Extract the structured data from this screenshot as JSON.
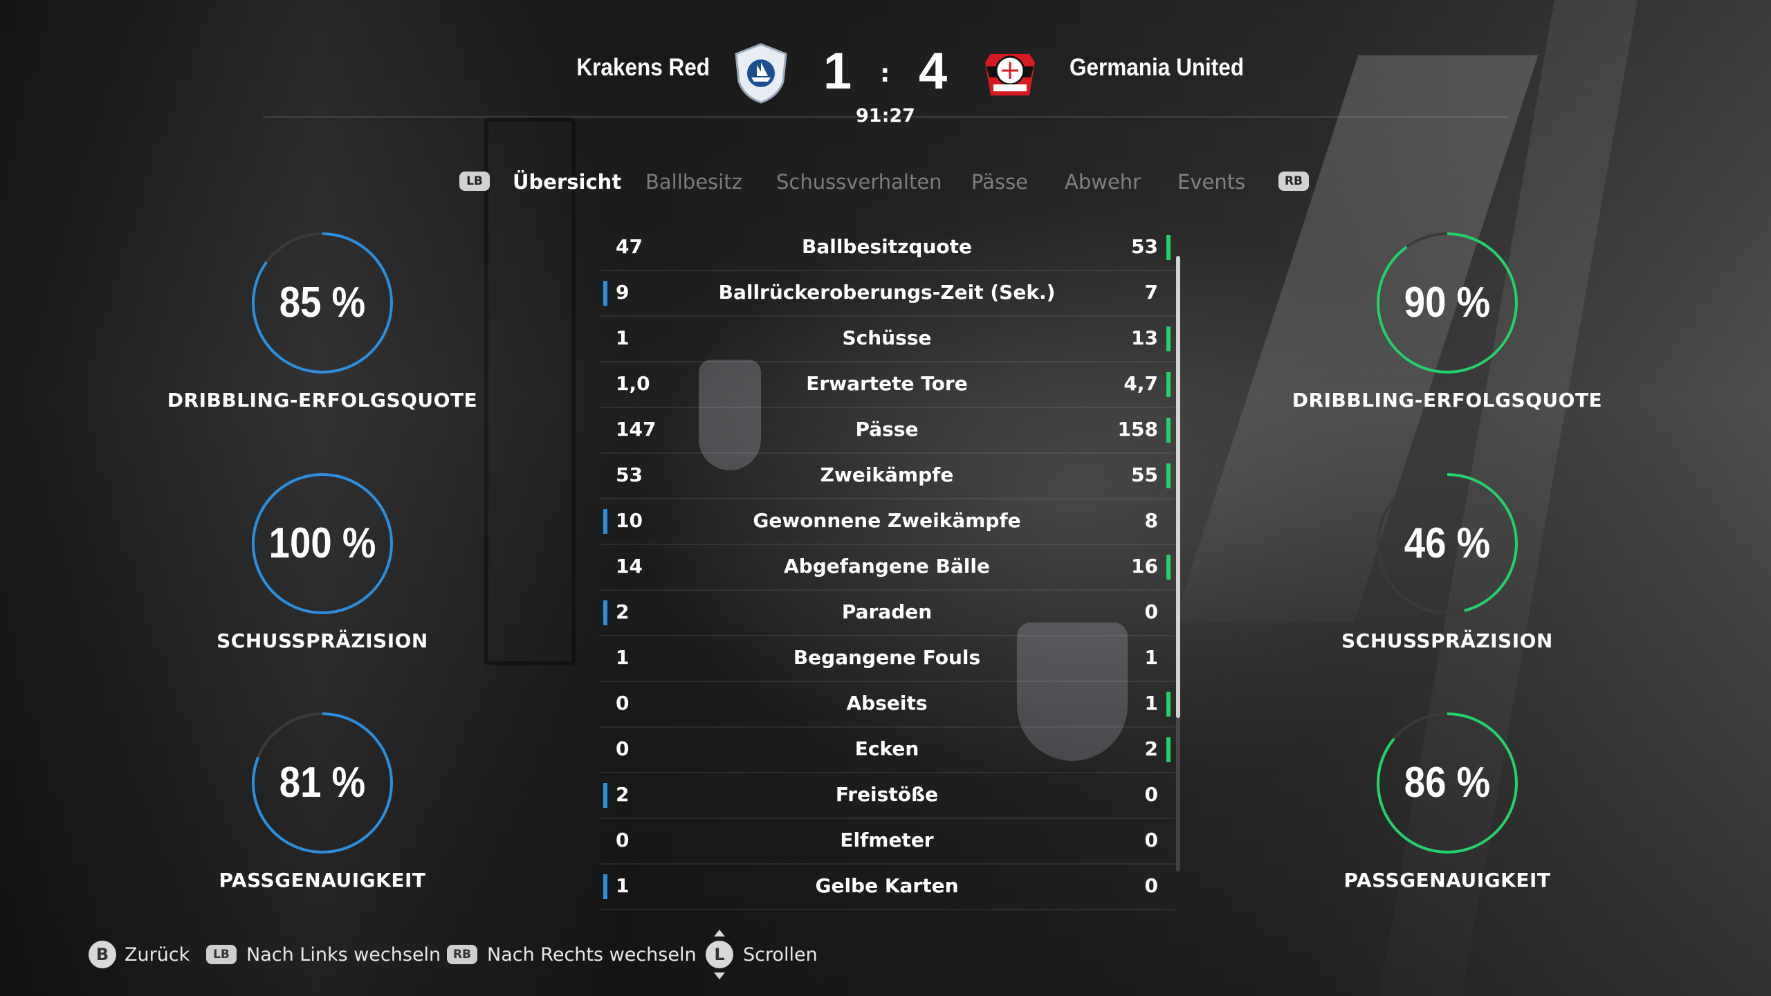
{
  "header": {
    "home_team": "Krakens Red",
    "away_team": "Germania United",
    "home_score": "1",
    "separator": ":",
    "away_score": "4",
    "clock": "91:27",
    "home_crest_icon": "kraken-shield-crest",
    "away_crest_icon": "bayer-leverkusen-crest"
  },
  "tabs": {
    "prev_pill": "LB",
    "next_pill": "RB",
    "items": [
      {
        "label": "Übersicht",
        "active": true
      },
      {
        "label": "Ballbesitz",
        "active": false
      },
      {
        "label": "Schussverhalten",
        "active": false
      },
      {
        "label": "Pässe",
        "active": false
      },
      {
        "label": "Abwehr",
        "active": false
      },
      {
        "label": "Events",
        "active": false
      }
    ]
  },
  "colors": {
    "home": "#2a8fe0",
    "away": "#22d36a",
    "track": "#3a3a3a"
  },
  "home_rings": [
    {
      "value": "85 %",
      "fraction": 0.85,
      "label": "DRIBBLING-ERFOLGSQUOTE"
    },
    {
      "value": "100 %",
      "fraction": 1.0,
      "label": "SCHUSSPRÄZISION"
    },
    {
      "value": "81 %",
      "fraction": 0.81,
      "label": "PASSGENAUIGKEIT"
    }
  ],
  "away_rings": [
    {
      "value": "90 %",
      "fraction": 0.9,
      "label": "DRIBBLING-ERFOLGSQUOTE"
    },
    {
      "value": "46 %",
      "fraction": 0.46,
      "label": "SCHUSSPRÄZISION"
    },
    {
      "value": "86 %",
      "fraction": 0.86,
      "label": "PASSGENAUIGKEIT"
    }
  ],
  "stats": [
    {
      "name": "Ballbesitzquote",
      "home": "47",
      "away": "53",
      "leader": "away"
    },
    {
      "name": "Ballrückeroberungs-Zeit (Sek.)",
      "home": "9",
      "away": "7",
      "leader": "home"
    },
    {
      "name": "Schüsse",
      "home": "1",
      "away": "13",
      "leader": "away"
    },
    {
      "name": "Erwartete Tore",
      "home": "1,0",
      "away": "4,7",
      "leader": "away"
    },
    {
      "name": "Pässe",
      "home": "147",
      "away": "158",
      "leader": "away"
    },
    {
      "name": "Zweikämpfe",
      "home": "53",
      "away": "55",
      "leader": "away"
    },
    {
      "name": "Gewonnene Zweikämpfe",
      "home": "10",
      "away": "8",
      "leader": "home"
    },
    {
      "name": "Abgefangene Bälle",
      "home": "14",
      "away": "16",
      "leader": "away"
    },
    {
      "name": "Paraden",
      "home": "2",
      "away": "0",
      "leader": "home"
    },
    {
      "name": "Begangene Fouls",
      "home": "1",
      "away": "1",
      "leader": "none"
    },
    {
      "name": "Abseits",
      "home": "0",
      "away": "1",
      "leader": "away"
    },
    {
      "name": "Ecken",
      "home": "0",
      "away": "2",
      "leader": "away"
    },
    {
      "name": "Freistöße",
      "home": "2",
      "away": "0",
      "leader": "home"
    },
    {
      "name": "Elfmeter",
      "home": "0",
      "away": "0",
      "leader": "none"
    },
    {
      "name": "Gelbe Karten",
      "home": "1",
      "away": "0",
      "leader": "home"
    }
  ],
  "footer": {
    "back_key": "B",
    "back_label": "Zurück",
    "left_key": "LB",
    "left_label": "Nach Links wechseln",
    "right_key": "RB",
    "right_label": "Nach Rechts wechseln",
    "scroll_key": "L",
    "scroll_label": "Scrollen"
  }
}
